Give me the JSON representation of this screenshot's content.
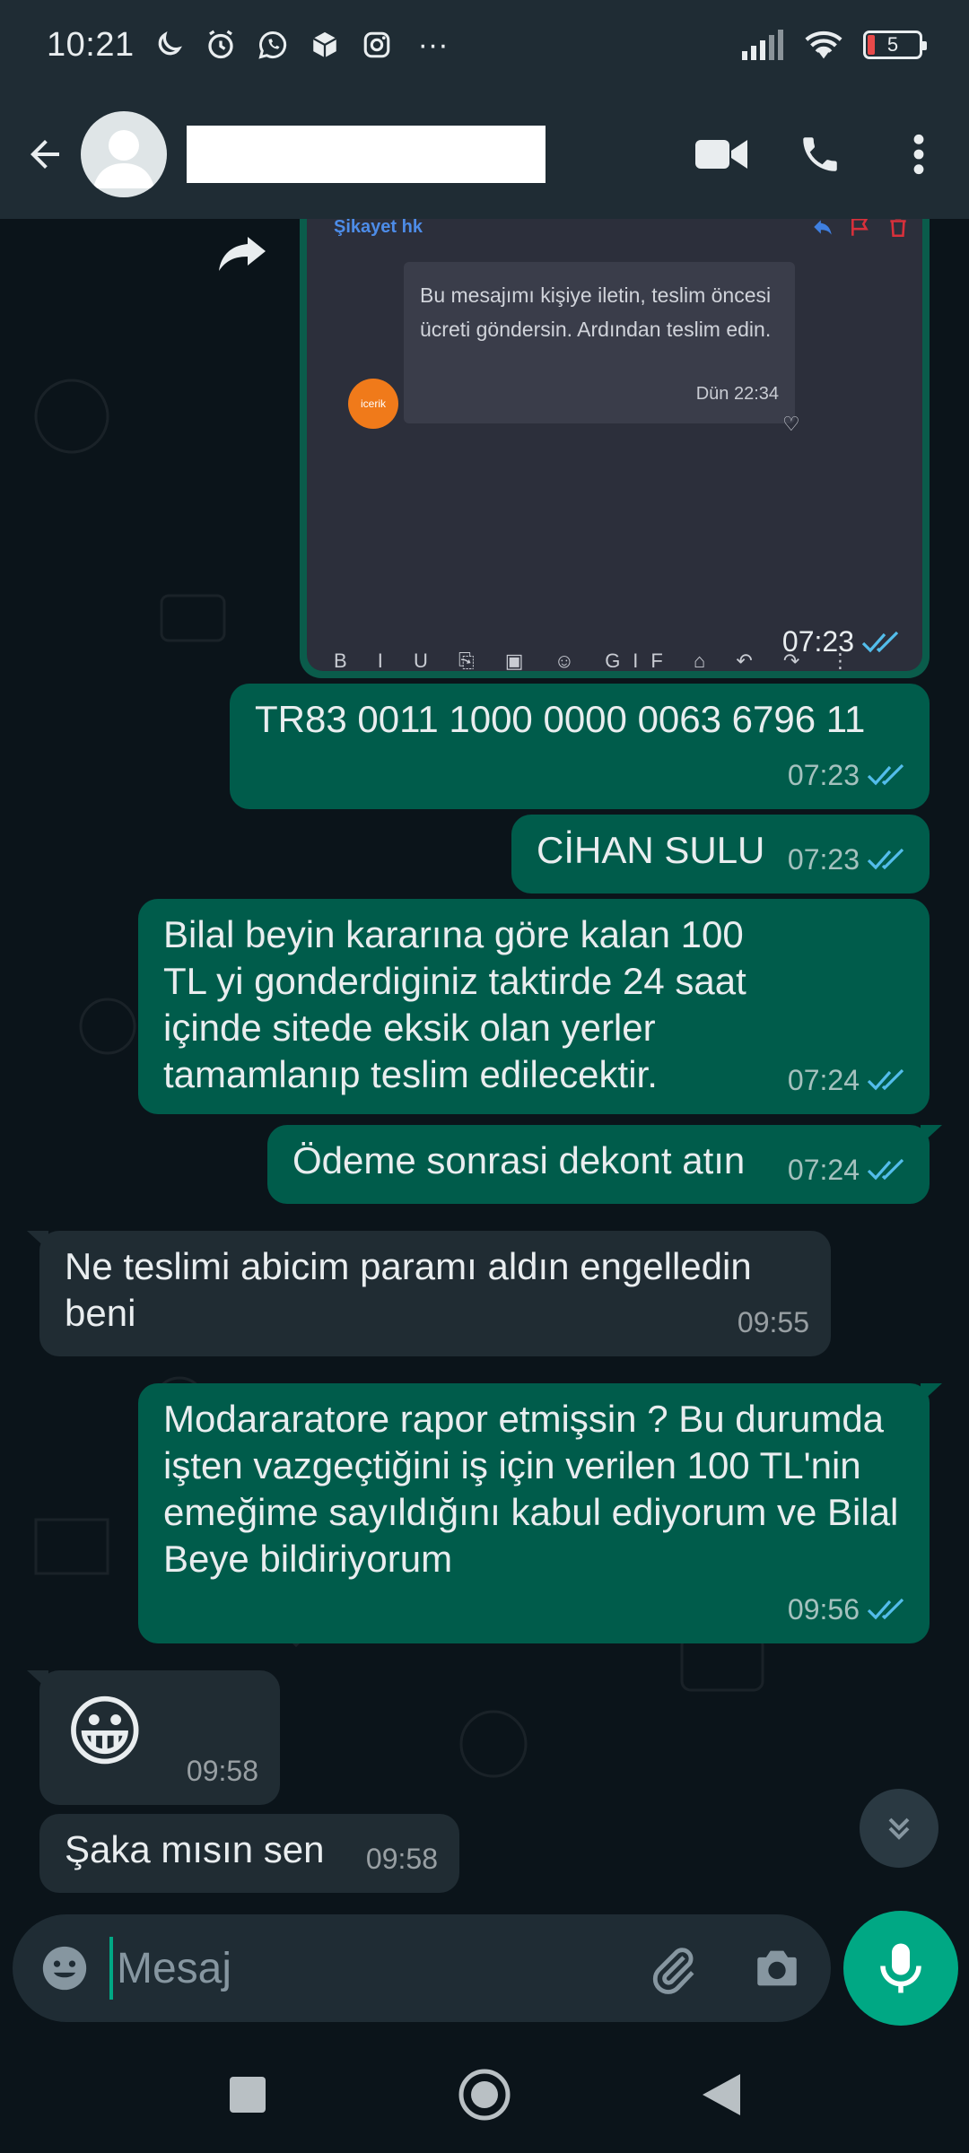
{
  "status_bar": {
    "time": "10:21",
    "battery": "5",
    "more": "···"
  },
  "header": {
    "icons": [
      "back-arrow-icon",
      "avatar",
      "video-call-icon",
      "phone-icon",
      "more-options-icon"
    ]
  },
  "colors": {
    "outgoing_bubble": "#005c4b",
    "incoming_bubble": "#202c33",
    "accent": "#00a884",
    "read_ticks": "#53bdeb"
  },
  "image_message": {
    "screenshot_title": "Şikayet hk",
    "screenshot_text": "Bu mesajımı kişiye iletin, teslim öncesi ücreti göndersin. Ardından teslim edin.",
    "screenshot_time": "Dün 22:34",
    "screenshot_logo": "icerik",
    "screenshot_toolbar": "B I U ⎘ ▣ ☺ GIF ⌂ ↶ ↷ ⋮",
    "time": "07:23"
  },
  "messages": [
    {
      "direction": "out",
      "text": "TR83 0011 1000 0000 0063 6796 11",
      "time": "07:23"
    },
    {
      "direction": "out",
      "text": "CİHAN SULU",
      "time": "07:23"
    },
    {
      "direction": "out",
      "text": "Bilal beyin kararına göre kalan 100 TL yi gonderdiginiz taktirde 24 saat içinde sitede eksik olan yerler tamamlanıp teslim edilecektir.",
      "time": "07:24"
    },
    {
      "direction": "out",
      "text": "Ödeme sonrasi dekont atın",
      "time": "07:24"
    },
    {
      "direction": "in",
      "text": "Ne teslimi abicim paramı aldın engelledin beni",
      "time": "09:55"
    },
    {
      "direction": "out",
      "text": "Modararatore rapor etmişsin ? Bu durumda işten vazgeçtiğini iş için verilen 100 TL'nin emeğime sayıldığını kabul ediyorum ve Bilal Beye bildiriyorum",
      "time": "09:56"
    },
    {
      "direction": "in",
      "text": "😀",
      "time": "09:58"
    },
    {
      "direction": "in",
      "text": "Şaka mısın sen",
      "time": "09:58"
    }
  ],
  "input": {
    "placeholder": "Mesaj"
  }
}
